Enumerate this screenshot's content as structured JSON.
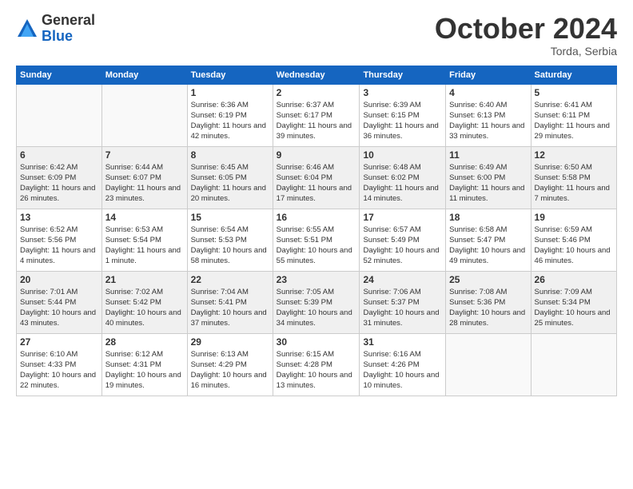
{
  "logo": {
    "general": "General",
    "blue": "Blue"
  },
  "title": "October 2024",
  "location": "Torda, Serbia",
  "weekdays": [
    "Sunday",
    "Monday",
    "Tuesday",
    "Wednesday",
    "Thursday",
    "Friday",
    "Saturday"
  ],
  "weeks": [
    [
      {
        "day": "",
        "sunrise": "",
        "sunset": "",
        "daylight": ""
      },
      {
        "day": "",
        "sunrise": "",
        "sunset": "",
        "daylight": ""
      },
      {
        "day": "1",
        "sunrise": "Sunrise: 6:36 AM",
        "sunset": "Sunset: 6:19 PM",
        "daylight": "Daylight: 11 hours and 42 minutes."
      },
      {
        "day": "2",
        "sunrise": "Sunrise: 6:37 AM",
        "sunset": "Sunset: 6:17 PM",
        "daylight": "Daylight: 11 hours and 39 minutes."
      },
      {
        "day": "3",
        "sunrise": "Sunrise: 6:39 AM",
        "sunset": "Sunset: 6:15 PM",
        "daylight": "Daylight: 11 hours and 36 minutes."
      },
      {
        "day": "4",
        "sunrise": "Sunrise: 6:40 AM",
        "sunset": "Sunset: 6:13 PM",
        "daylight": "Daylight: 11 hours and 33 minutes."
      },
      {
        "day": "5",
        "sunrise": "Sunrise: 6:41 AM",
        "sunset": "Sunset: 6:11 PM",
        "daylight": "Daylight: 11 hours and 29 minutes."
      }
    ],
    [
      {
        "day": "6",
        "sunrise": "Sunrise: 6:42 AM",
        "sunset": "Sunset: 6:09 PM",
        "daylight": "Daylight: 11 hours and 26 minutes."
      },
      {
        "day": "7",
        "sunrise": "Sunrise: 6:44 AM",
        "sunset": "Sunset: 6:07 PM",
        "daylight": "Daylight: 11 hours and 23 minutes."
      },
      {
        "day": "8",
        "sunrise": "Sunrise: 6:45 AM",
        "sunset": "Sunset: 6:05 PM",
        "daylight": "Daylight: 11 hours and 20 minutes."
      },
      {
        "day": "9",
        "sunrise": "Sunrise: 6:46 AM",
        "sunset": "Sunset: 6:04 PM",
        "daylight": "Daylight: 11 hours and 17 minutes."
      },
      {
        "day": "10",
        "sunrise": "Sunrise: 6:48 AM",
        "sunset": "Sunset: 6:02 PM",
        "daylight": "Daylight: 11 hours and 14 minutes."
      },
      {
        "day": "11",
        "sunrise": "Sunrise: 6:49 AM",
        "sunset": "Sunset: 6:00 PM",
        "daylight": "Daylight: 11 hours and 11 minutes."
      },
      {
        "day": "12",
        "sunrise": "Sunrise: 6:50 AM",
        "sunset": "Sunset: 5:58 PM",
        "daylight": "Daylight: 11 hours and 7 minutes."
      }
    ],
    [
      {
        "day": "13",
        "sunrise": "Sunrise: 6:52 AM",
        "sunset": "Sunset: 5:56 PM",
        "daylight": "Daylight: 11 hours and 4 minutes."
      },
      {
        "day": "14",
        "sunrise": "Sunrise: 6:53 AM",
        "sunset": "Sunset: 5:54 PM",
        "daylight": "Daylight: 11 hours and 1 minute."
      },
      {
        "day": "15",
        "sunrise": "Sunrise: 6:54 AM",
        "sunset": "Sunset: 5:53 PM",
        "daylight": "Daylight: 10 hours and 58 minutes."
      },
      {
        "day": "16",
        "sunrise": "Sunrise: 6:55 AM",
        "sunset": "Sunset: 5:51 PM",
        "daylight": "Daylight: 10 hours and 55 minutes."
      },
      {
        "day": "17",
        "sunrise": "Sunrise: 6:57 AM",
        "sunset": "Sunset: 5:49 PM",
        "daylight": "Daylight: 10 hours and 52 minutes."
      },
      {
        "day": "18",
        "sunrise": "Sunrise: 6:58 AM",
        "sunset": "Sunset: 5:47 PM",
        "daylight": "Daylight: 10 hours and 49 minutes."
      },
      {
        "day": "19",
        "sunrise": "Sunrise: 6:59 AM",
        "sunset": "Sunset: 5:46 PM",
        "daylight": "Daylight: 10 hours and 46 minutes."
      }
    ],
    [
      {
        "day": "20",
        "sunrise": "Sunrise: 7:01 AM",
        "sunset": "Sunset: 5:44 PM",
        "daylight": "Daylight: 10 hours and 43 minutes."
      },
      {
        "day": "21",
        "sunrise": "Sunrise: 7:02 AM",
        "sunset": "Sunset: 5:42 PM",
        "daylight": "Daylight: 10 hours and 40 minutes."
      },
      {
        "day": "22",
        "sunrise": "Sunrise: 7:04 AM",
        "sunset": "Sunset: 5:41 PM",
        "daylight": "Daylight: 10 hours and 37 minutes."
      },
      {
        "day": "23",
        "sunrise": "Sunrise: 7:05 AM",
        "sunset": "Sunset: 5:39 PM",
        "daylight": "Daylight: 10 hours and 34 minutes."
      },
      {
        "day": "24",
        "sunrise": "Sunrise: 7:06 AM",
        "sunset": "Sunset: 5:37 PM",
        "daylight": "Daylight: 10 hours and 31 minutes."
      },
      {
        "day": "25",
        "sunrise": "Sunrise: 7:08 AM",
        "sunset": "Sunset: 5:36 PM",
        "daylight": "Daylight: 10 hours and 28 minutes."
      },
      {
        "day": "26",
        "sunrise": "Sunrise: 7:09 AM",
        "sunset": "Sunset: 5:34 PM",
        "daylight": "Daylight: 10 hours and 25 minutes."
      }
    ],
    [
      {
        "day": "27",
        "sunrise": "Sunrise: 6:10 AM",
        "sunset": "Sunset: 4:33 PM",
        "daylight": "Daylight: 10 hours and 22 minutes."
      },
      {
        "day": "28",
        "sunrise": "Sunrise: 6:12 AM",
        "sunset": "Sunset: 4:31 PM",
        "daylight": "Daylight: 10 hours and 19 minutes."
      },
      {
        "day": "29",
        "sunrise": "Sunrise: 6:13 AM",
        "sunset": "Sunset: 4:29 PM",
        "daylight": "Daylight: 10 hours and 16 minutes."
      },
      {
        "day": "30",
        "sunrise": "Sunrise: 6:15 AM",
        "sunset": "Sunset: 4:28 PM",
        "daylight": "Daylight: 10 hours and 13 minutes."
      },
      {
        "day": "31",
        "sunrise": "Sunrise: 6:16 AM",
        "sunset": "Sunset: 4:26 PM",
        "daylight": "Daylight: 10 hours and 10 minutes."
      },
      {
        "day": "",
        "sunrise": "",
        "sunset": "",
        "daylight": ""
      },
      {
        "day": "",
        "sunrise": "",
        "sunset": "",
        "daylight": ""
      }
    ]
  ]
}
